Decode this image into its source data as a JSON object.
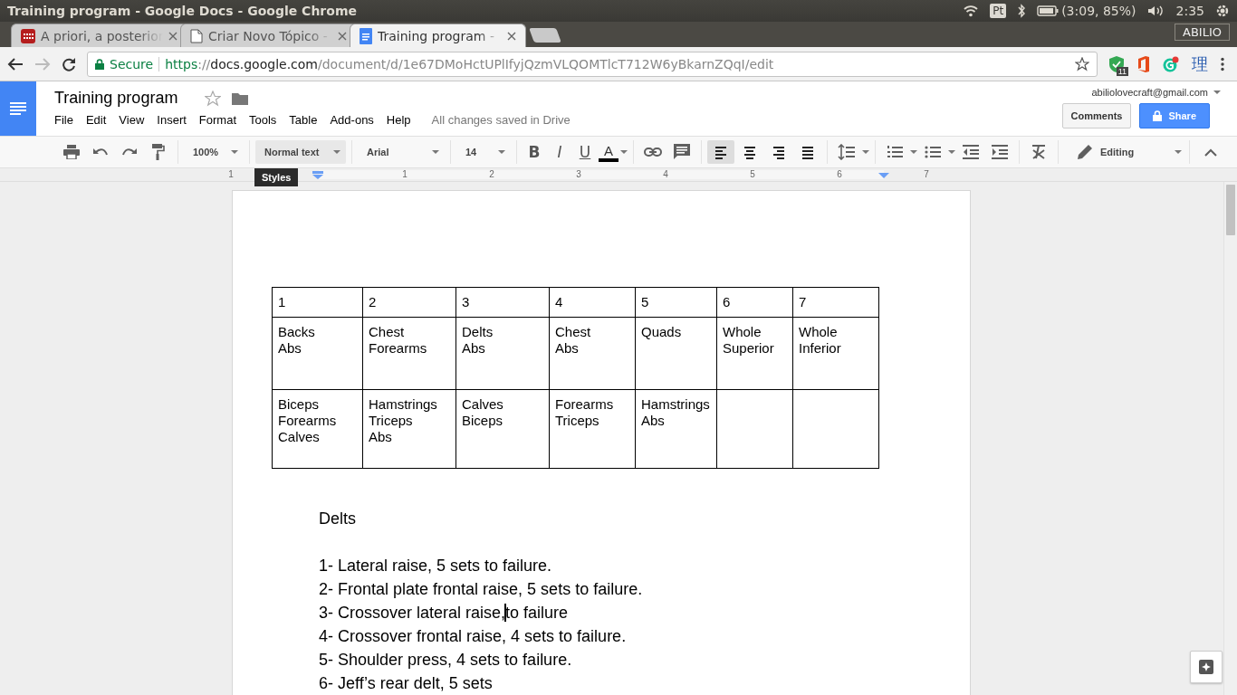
{
  "system_bar": {
    "window_title": "Training program - Google Docs - Google Chrome",
    "keyboard": "Pt",
    "battery": "(3:09, 85%)",
    "clock": "2:35"
  },
  "browser": {
    "tabs": [
      {
        "title": "A priori, a posterior",
        "kind": "app",
        "selected": false
      },
      {
        "title": "Criar Novo Tópico -",
        "kind": "page",
        "selected": false
      },
      {
        "title": "Training program -",
        "kind": "docs",
        "selected": true
      }
    ],
    "profile": "ABILIO",
    "security": "Secure",
    "url": [
      {
        "kind": "scheme",
        "text": "https"
      },
      {
        "kind": "dim",
        "text": "://"
      },
      {
        "kind": "host",
        "text": "docs.google.com"
      },
      {
        "kind": "dim",
        "text": "/document/d/1e67DMoHctUPlIfyjQzmVLQOMTlcT712W6yBkarnZQqI/edit"
      }
    ],
    "extension_badge": "11",
    "extension_text": "理"
  },
  "docs": {
    "title": "Training program",
    "menu": [
      "File",
      "Edit",
      "View",
      "Insert",
      "Format",
      "Tools",
      "Table",
      "Add-ons",
      "Help"
    ],
    "save_status": "All changes saved in Drive",
    "account": "abiliolovecraft@gmail.com",
    "comments": "Comments",
    "share": "Share"
  },
  "toolbar": {
    "zoom": "100%",
    "style": "Normal text",
    "font": "Arial",
    "size": "14",
    "bold": "B",
    "italic": "I",
    "underline": "U",
    "text_color": "A",
    "tooltip": "Styles",
    "alignment": [
      {
        "kind": "left",
        "selected": true
      },
      {
        "kind": "center",
        "selected": false
      },
      {
        "kind": "right",
        "selected": false
      },
      {
        "kind": "justify",
        "selected": false
      }
    ],
    "mode": "Editing"
  },
  "ruler": [
    "1",
    "1",
    "2",
    "3",
    "4",
    "5",
    "6",
    "7"
  ],
  "table": {
    "rows": [
      [
        "1",
        "2",
        "3",
        "4",
        "5",
        "6",
        "7"
      ],
      [
        "Backs\nAbs",
        "Chest\nForearms",
        "Delts\nAbs",
        "Chest\nAbs",
        "Quads",
        "Whole\nSuperior",
        "Whole\nInferior"
      ],
      [
        "Biceps\nForearms\nCalves",
        "Hamstrings\nTriceps\nAbs",
        "Calves\nBiceps",
        "Forearms\nTriceps",
        "Hamstrings\nAbs",
        null,
        null
      ]
    ]
  },
  "body": [
    {
      "kind": "heading",
      "text": "Delts"
    },
    {
      "kind": "item",
      "text": "1- Lateral raise, 5 sets to failure."
    },
    {
      "kind": "item",
      "text": "2- Frontal plate frontal raise, 5 sets to failure."
    },
    {
      "kind": "item",
      "text": "3- Crossover lateral raise,",
      "text_after_cursor": "to failure"
    },
    {
      "kind": "item",
      "text": "4- Crossover frontal raise, 4 sets to failure."
    },
    {
      "kind": "item",
      "text": "5- Shoulder press, 4 sets to failure."
    },
    {
      "kind": "item",
      "text": "6- Jeff’s rear delt, 5 sets"
    }
  ]
}
